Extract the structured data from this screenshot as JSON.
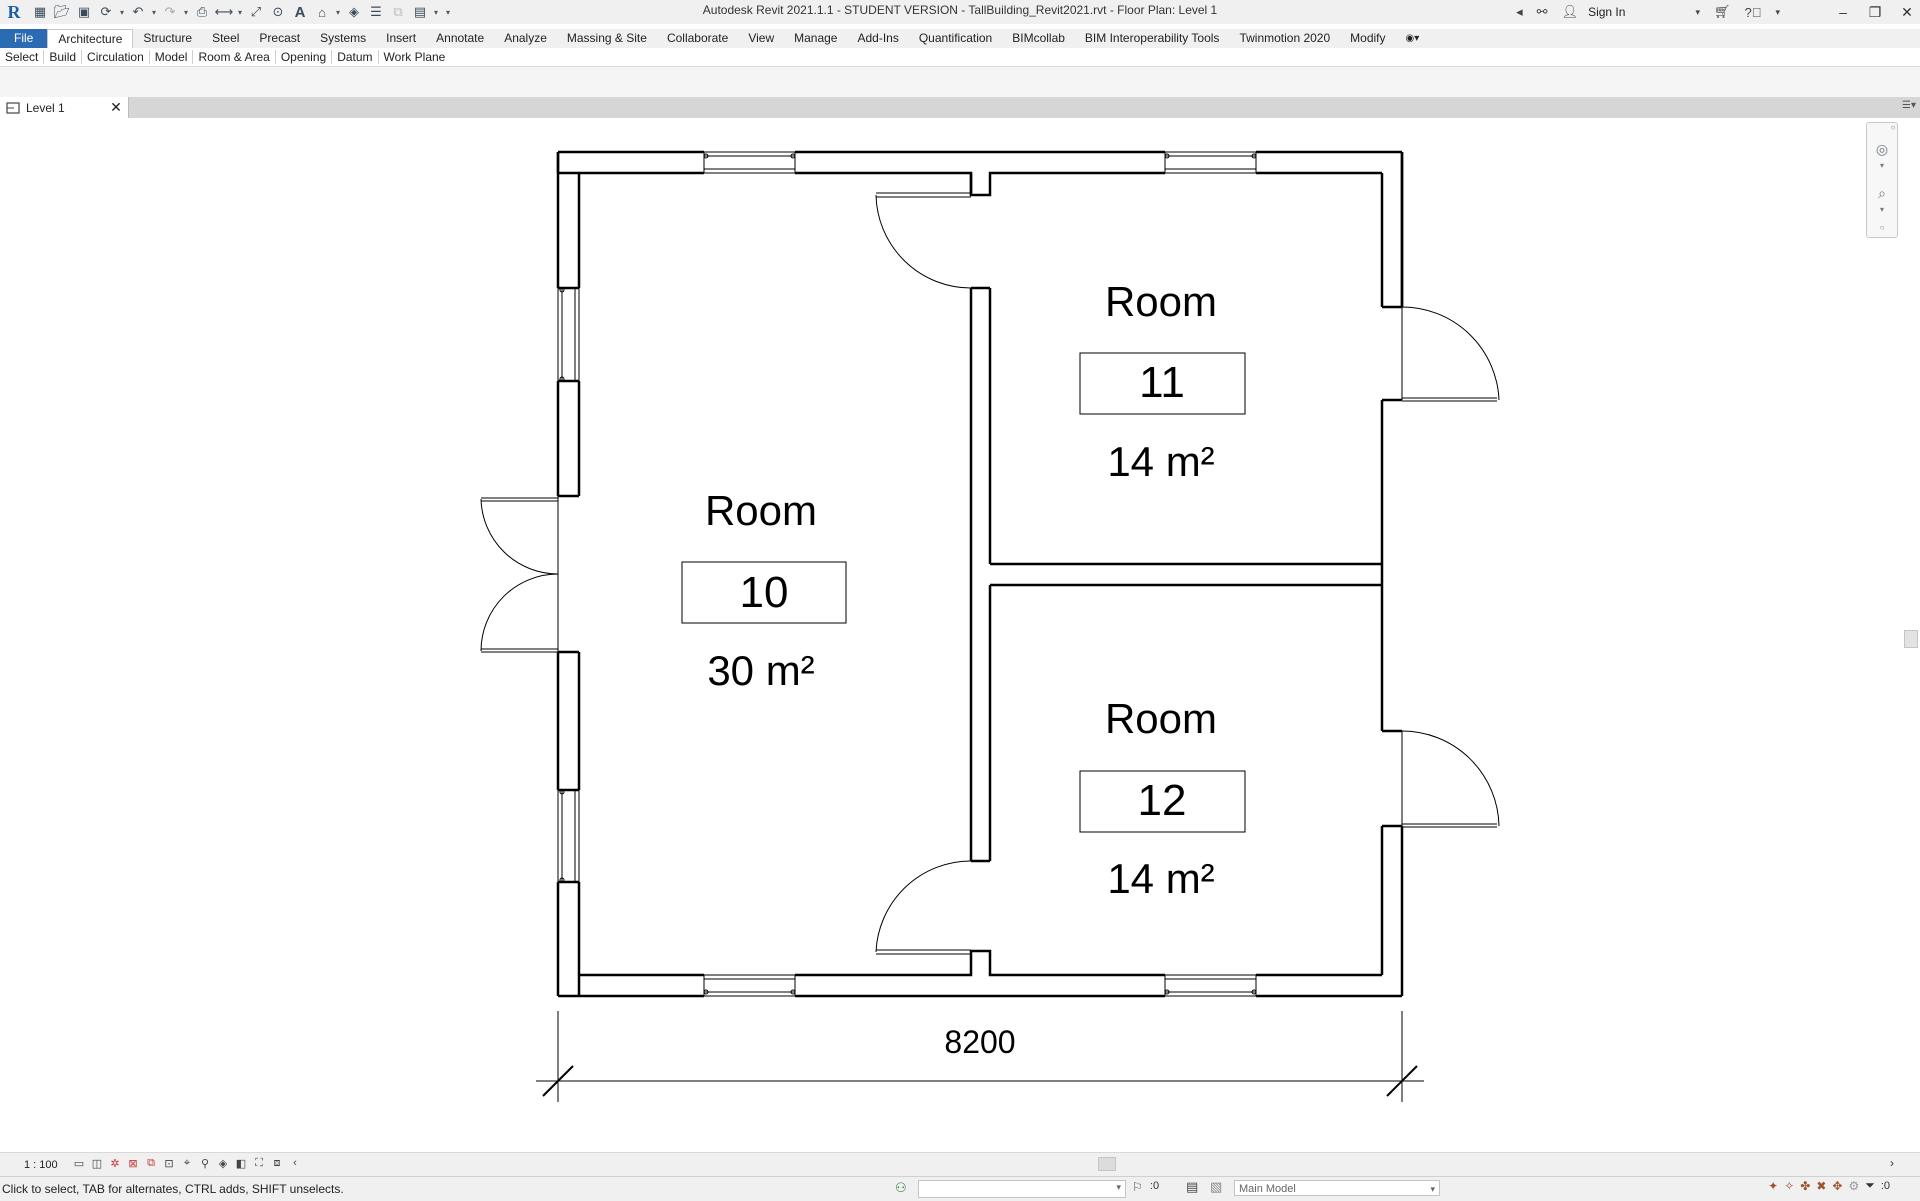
{
  "app": {
    "title": "Autodesk Revit 2021.1.1 - STUDENT VERSION - TallBuilding_Revit2021.rvt - Floor Plan: Level 1",
    "sign_in": "Sign In",
    "logo": "R"
  },
  "ribbon_tabs": [
    {
      "label": "File"
    },
    {
      "label": "Architecture"
    },
    {
      "label": "Structure"
    },
    {
      "label": "Steel"
    },
    {
      "label": "Precast"
    },
    {
      "label": "Systems"
    },
    {
      "label": "Insert"
    },
    {
      "label": "Annotate"
    },
    {
      "label": "Analyze"
    },
    {
      "label": "Massing & Site"
    },
    {
      "label": "Collaborate"
    },
    {
      "label": "View"
    },
    {
      "label": "Manage"
    },
    {
      "label": "Add-Ins"
    },
    {
      "label": "Quantification"
    },
    {
      "label": "BIMcollab"
    },
    {
      "label": "BIM Interoperability Tools"
    },
    {
      "label": "Twinmotion 2020"
    },
    {
      "label": "Modify"
    }
  ],
  "ribbon_panels": [
    {
      "label": "Select"
    },
    {
      "label": "Build"
    },
    {
      "label": "Circulation"
    },
    {
      "label": "Model"
    },
    {
      "label": "Room & Area"
    },
    {
      "label": "Opening"
    },
    {
      "label": "Datum"
    },
    {
      "label": "Work Plane"
    }
  ],
  "view_tab": {
    "label": "Level 1",
    "close": "✕"
  },
  "plan": {
    "rooms": [
      {
        "name": "Room",
        "number": "10",
        "area": "30 m²"
      },
      {
        "name": "Room",
        "number": "11",
        "area": "14 m²"
      },
      {
        "name": "Room",
        "number": "12",
        "area": "14 m²"
      }
    ],
    "dimension": "8200"
  },
  "view_control": {
    "scale": "1 : 100"
  },
  "status": {
    "message": "Click to select, TAB for alternates, CTRL adds, SHIFT unselects.",
    "workset_count": ":0",
    "model": "Main Model",
    "filter_count": ":0"
  },
  "icons": {
    "qat": [
      "open-icon",
      "save-icon",
      "sync-icon",
      "undo-icon",
      "redo-icon",
      "print-icon",
      "measure-icon",
      "text-icon"
    ],
    "nav": [
      "steering-wheel-icon",
      "zoom-icon"
    ]
  }
}
